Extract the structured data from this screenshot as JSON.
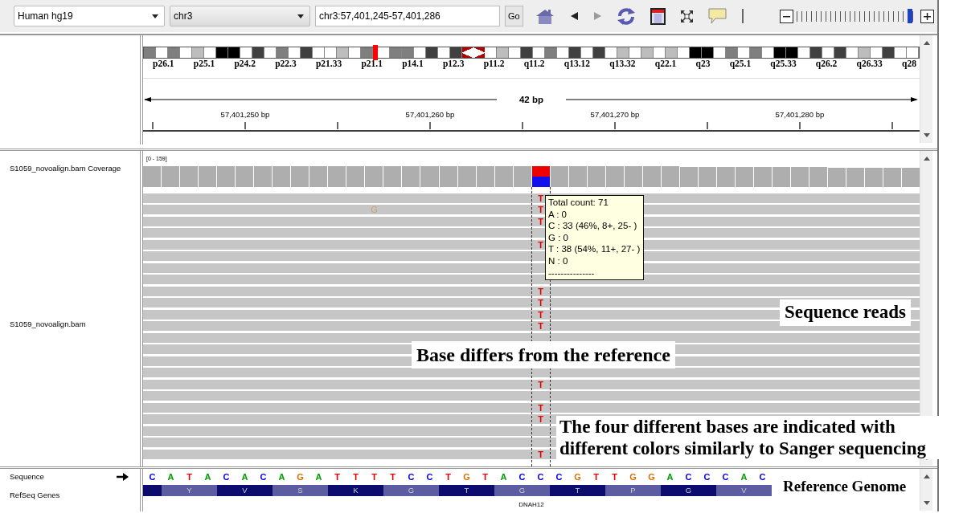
{
  "toolbar": {
    "genome": "Human hg19",
    "chromosome": "chr3",
    "locus": "chr3:57,401,245-57,401,286",
    "go": "Go",
    "back": {
      "disabled": false
    },
    "forward": {
      "disabled": true
    },
    "zoom": {
      "level": 0.96
    }
  },
  "ideogram": {
    "bands": [
      {
        "color": "#7f7f7f"
      },
      {
        "color": "#ffffff"
      },
      {
        "color": "#7f7f7f"
      },
      {
        "color": "#ffffff"
      },
      {
        "color": "#bdbdbd"
      },
      {
        "color": "#ffffff"
      },
      {
        "color": "#000000"
      },
      {
        "color": "#000000"
      },
      {
        "color": "#ffffff"
      },
      {
        "color": "#404040"
      },
      {
        "color": "#ffffff"
      },
      {
        "color": "#7f7f7f"
      },
      {
        "color": "#ffffff"
      },
      {
        "color": "#404040"
      },
      {
        "color": "#ffffff"
      },
      {
        "color": "#ffffff"
      },
      {
        "color": "#bdbdbd"
      },
      {
        "color": "#ffffff"
      },
      {
        "color": "#7f7f7f"
      },
      {
        "kind": "marker"
      },
      {
        "color": "#ffffff"
      },
      {
        "color": "#7f7f7f"
      },
      {
        "color": "#7f7f7f"
      },
      {
        "color": "#ffffff"
      },
      {
        "color": "#404040"
      },
      {
        "color": "#ffffff"
      },
      {
        "color": "#404040"
      },
      {
        "kind": "centromere-p"
      },
      {
        "kind": "centromere-q"
      },
      {
        "color": "#ffffff"
      },
      {
        "color": "#bdbdbd"
      },
      {
        "color": "#ffffff"
      },
      {
        "color": "#404040"
      },
      {
        "color": "#ffffff"
      },
      {
        "color": "#7f7f7f"
      },
      {
        "color": "#ffffff"
      },
      {
        "color": "#404040"
      },
      {
        "color": "#ffffff"
      },
      {
        "color": "#404040"
      },
      {
        "color": "#ffffff"
      },
      {
        "color": "#bdbdbd"
      },
      {
        "color": "#ffffff"
      },
      {
        "color": "#bdbdbd"
      },
      {
        "color": "#ffffff"
      },
      {
        "color": "#bdbdbd"
      },
      {
        "color": "#ffffff"
      },
      {
        "color": "#000000"
      },
      {
        "color": "#000000"
      },
      {
        "color": "#ffffff"
      },
      {
        "color": "#7f7f7f"
      },
      {
        "color": "#ffffff"
      },
      {
        "color": "#7f7f7f"
      },
      {
        "color": "#ffffff"
      },
      {
        "color": "#000000"
      },
      {
        "color": "#000000"
      },
      {
        "color": "#ffffff"
      },
      {
        "color": "#404040"
      },
      {
        "color": "#ffffff"
      },
      {
        "color": "#404040"
      },
      {
        "color": "#ffffff"
      },
      {
        "color": "#bdbdbd"
      },
      {
        "color": "#ffffff"
      },
      {
        "color": "#404040"
      },
      {
        "color": "#ffffff"
      },
      {
        "color": "#ffffff"
      }
    ],
    "labels": [
      "p26.1",
      "p25.1",
      "p24.2",
      "p22.3",
      "p21.33",
      "p21.1",
      "p14.1",
      "p12.3",
      "p11.2",
      "q11.2",
      "q13.12",
      "q13.32",
      "q22.1",
      "q23",
      "q25.1",
      "q25.33",
      "q26.2",
      "q26.33",
      "q28"
    ]
  },
  "ruler": {
    "span": "42 bp",
    "ticks": [
      "57,401,250 bp",
      "57,401,260 bp",
      "57,401,270 bp",
      "57,401,280 bp"
    ]
  },
  "coverage": {
    "name": "S1059_novoalign.bam Coverage",
    "range": "[0 - 159]"
  },
  "alignments": {
    "name": "S1059_novoalign.bam",
    "mismatches": [
      {
        "base": "T",
        "faint": false
      },
      {
        "base": "G",
        "faint": true
      },
      {
        "base": "T",
        "faint": false
      },
      {
        "base": "T",
        "faint": false
      },
      {
        "base": "T",
        "faint": false
      },
      {
        "base": "T",
        "faint": false
      },
      {
        "base": "T",
        "faint": false
      },
      {
        "base": "T",
        "faint": false
      },
      {
        "base": "T",
        "faint": false
      },
      {
        "base": "T",
        "faint": false
      },
      {
        "base": "T",
        "faint": false
      },
      {
        "base": "T",
        "faint": false
      },
      {
        "base": "T",
        "faint": false
      }
    ]
  },
  "tooltip": {
    "lines": [
      "Total count: 71",
      "A : 0",
      "C : 33 (46%, 8+, 25- )",
      "G : 0",
      "T : 38 (54%, 11+, 27- )",
      "N : 0",
      "---------------"
    ]
  },
  "sequence": {
    "name": "Sequence",
    "bases": [
      "C",
      "A",
      "T",
      "A",
      "C",
      "A",
      "C",
      "A",
      "G",
      "A",
      "T",
      "T",
      "T",
      "T",
      "C",
      "C",
      "T",
      "G",
      "T",
      "A",
      "C",
      "C",
      "C",
      "G",
      "T",
      "T",
      "G",
      "G",
      "A",
      "C",
      "C",
      "C",
      "A",
      "C"
    ]
  },
  "genes": {
    "name": "RefSeq Genes",
    "codons": [
      {
        "partial": true
      },
      {
        "aa": "Y"
      },
      {
        "aa": "V"
      },
      {
        "aa": "S"
      },
      {
        "aa": "K"
      },
      {
        "aa": "G"
      },
      {
        "aa": "T"
      },
      {
        "aa": "G"
      },
      {
        "aa": "T"
      },
      {
        "aa": "P"
      },
      {
        "aa": "G"
      },
      {
        "aa": "V"
      }
    ],
    "gene": "DNAH12"
  },
  "annotations": [
    "Sequence reads",
    "Base differs from the reference",
    "The four different bases are indicated with different colors similarly to Sanger sequencing",
    "Reference Genome"
  ]
}
